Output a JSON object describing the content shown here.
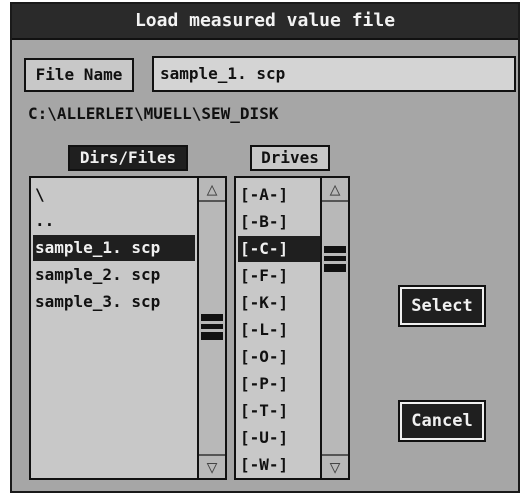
{
  "dialog": {
    "title": "Load measured value file"
  },
  "file_name": {
    "label": "File Name",
    "value": "sample_1. scp"
  },
  "current_path": "C:\\ALLERLEI\\MUELL\\SEW_DISK",
  "dirs_files": {
    "header": "Dirs/Files",
    "items": [
      "\\",
      "..",
      "sample_1. scp",
      "sample_2. scp",
      "sample_3. scp"
    ],
    "selected_index": 2
  },
  "drives": {
    "header": "Drives",
    "items": [
      "[-A-]",
      "[-B-]",
      "[-C-]",
      "[-F-]",
      "[-K-]",
      "[-L-]",
      "[-O-]",
      "[-P-]",
      "[-T-]",
      "[-U-]",
      "[-W-]"
    ],
    "selected_index": 2
  },
  "buttons": {
    "select": "Select",
    "cancel": "Cancel"
  },
  "icons": {
    "scroll_up": "triangle-up-icon",
    "scroll_down": "triangle-down-icon",
    "cursor": "mouse-pointer-icon"
  },
  "colors": {
    "window_bg": "#a6a6a6",
    "title_bg": "#2a2a2a",
    "selection_bg": "#1f1f1f",
    "list_bg": "#c8c8c8"
  }
}
